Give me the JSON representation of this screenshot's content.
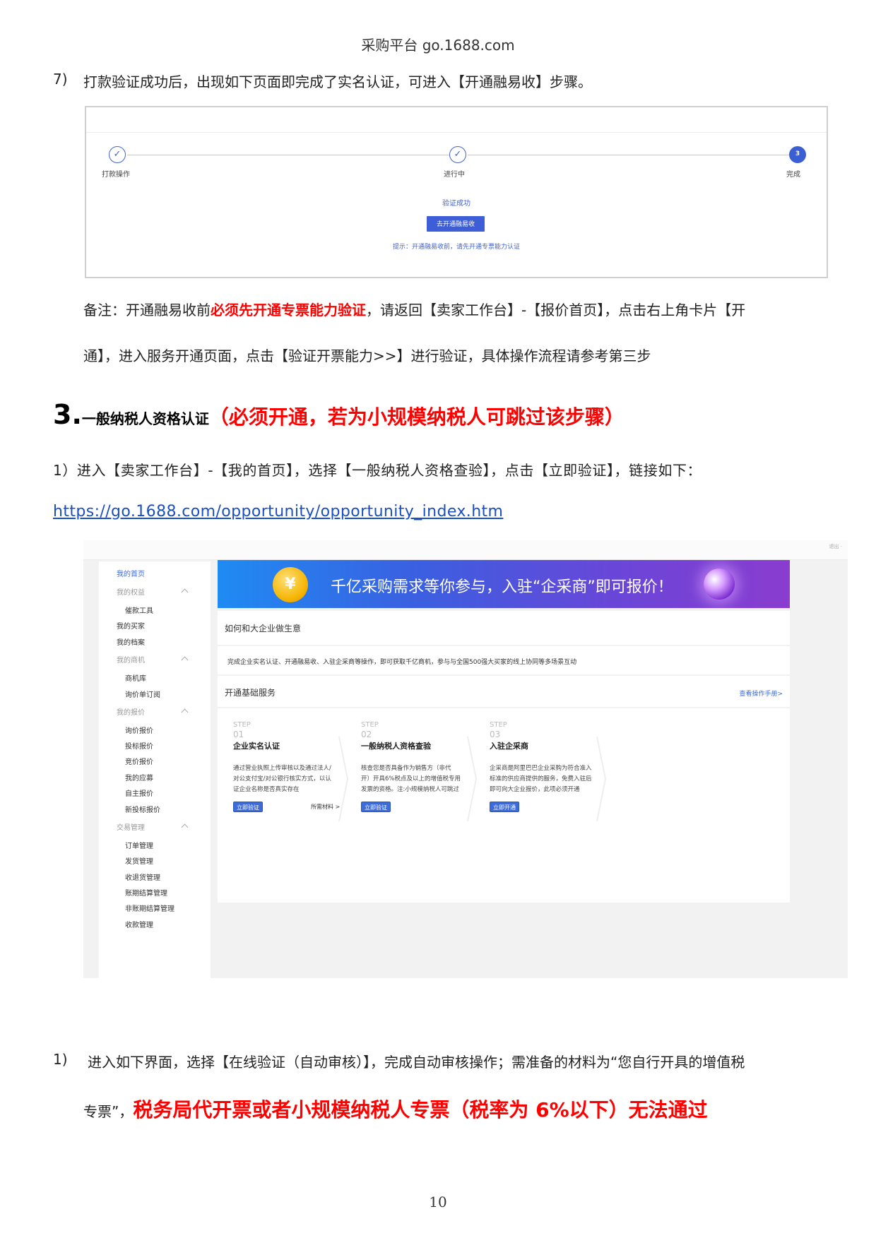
{
  "header": {
    "title": "采购平台 go.1688.com"
  },
  "step7": {
    "number": "7)",
    "text": "打款验证成功后，出现如下页面即完成了实名认证，可进入【开通融易收】步骤。"
  },
  "screenshot1": {
    "steps": [
      {
        "label": "打款操作",
        "icon": "check-icon"
      },
      {
        "label": "进行中",
        "icon": "check-icon"
      },
      {
        "label": "完成",
        "number": "3"
      }
    ],
    "status": "验证成功",
    "button": "去开通融易收",
    "hint": "提示：开通融易收前，请先开通专票能力认证"
  },
  "note": {
    "prefix": "备注：开通融易收前",
    "highlight": "必须先开通专票能力验证",
    "rest_line1": "，请返回【卖家工作台】-【报价首页】，点击右上角卡片【开",
    "line2": "通】，进入服务开通页面，点击【验证开票能力>>】进行验证，具体操作流程请参考第三步"
  },
  "section3": {
    "number": "3.",
    "title": "一般纳税人资格认证",
    "note": "（必须开通，若为小规模纳税人可跳过该步骤）",
    "step1": "1）进入【卖家工作台】-【我的首页】，选择【一般纳税人资格查验】，点击【立即验证】，链接如下：",
    "link": "https://go.1688.com/opportunity/opportunity_index.htm"
  },
  "screenshot2": {
    "corner_tag": "退出 ·",
    "sidebar": [
      {
        "label": "我的首页",
        "type": "top"
      },
      {
        "label": "我的权益",
        "type": "group"
      },
      {
        "label": "催款工具",
        "type": "sub"
      },
      {
        "label": "我的买家",
        "type": "top-plain"
      },
      {
        "label": "我的档案",
        "type": "top-plain"
      },
      {
        "label": "我的商机",
        "type": "group"
      },
      {
        "label": "商机库",
        "type": "sub"
      },
      {
        "label": "询价单订阅",
        "type": "sub"
      },
      {
        "label": "我的报价",
        "type": "group"
      },
      {
        "label": "询价报价",
        "type": "sub"
      },
      {
        "label": "投标报价",
        "type": "sub"
      },
      {
        "label": "竞价报价",
        "type": "sub"
      },
      {
        "label": "我的应募",
        "type": "sub"
      },
      {
        "label": "自主报价",
        "type": "sub"
      },
      {
        "label": "新投标报价",
        "type": "sub"
      },
      {
        "label": "交易管理",
        "type": "group"
      },
      {
        "label": "订单管理",
        "type": "sub"
      },
      {
        "label": "发货管理",
        "type": "sub"
      },
      {
        "label": "收退货管理",
        "type": "sub"
      },
      {
        "label": "账期结算管理",
        "type": "sub"
      },
      {
        "label": "非账期结算管理",
        "type": "sub"
      },
      {
        "label": "收款管理",
        "type": "sub"
      }
    ],
    "banner": "千亿采购需求等你参与，入驻“企采商”即可报价！",
    "card1_title": "如何和大企业做生意",
    "card1_desc": "完成企业实名认证、开通融易收、入驻企采商等操作，即可获取千亿商机，参与与全国500强大买家的线上协同等多场景互动",
    "card2_title": "开通基础服务",
    "card2_link": "查看操作手册>",
    "steps": [
      {
        "tag": "STEP",
        "num": "01",
        "name": "企业实名认证",
        "desc": [
          "通过营业执照上传审核以及通过法人/",
          "对公支付宝/对公银行核实方式，以认",
          "证企业名称是否真实存在"
        ],
        "button": "立即验证",
        "extra": "所需材料 >"
      },
      {
        "tag": "STEP",
        "num": "02",
        "name": "一般纳税人资格查验",
        "desc": [
          "核查您是否具备作为销售方（非代",
          "开）开具6%税点及以上的增值税专用",
          "发票的资格。注:小规模纳税人可跳过"
        ],
        "button": "立即验证",
        "extra": ""
      },
      {
        "tag": "STEP",
        "num": "03",
        "name": "入驻企采商",
        "desc": [
          "企采商是阿里巴巴企业采购为符合准入",
          "标准的供应商提供的服务，免费入驻后",
          "即可向大企业报价，此项必须开通"
        ],
        "button": "立即开通",
        "extra": ""
      }
    ]
  },
  "step1b": {
    "number": "1)",
    "line1": "进入如下界面，选择【在线验证（自动审核）】，完成自动审核操作；需准备的材料为“您自行开具的增值税",
    "line2_prefix": "专票”，",
    "line2_highlight": "税务局代开票或者小规模纳税人专票（税率为 6%以下）无法通过"
  },
  "footer": {
    "page": "10"
  },
  "colors": {
    "accent": "#3d5ed6",
    "warning": "#ff0000",
    "link": "#1a4fc2"
  }
}
